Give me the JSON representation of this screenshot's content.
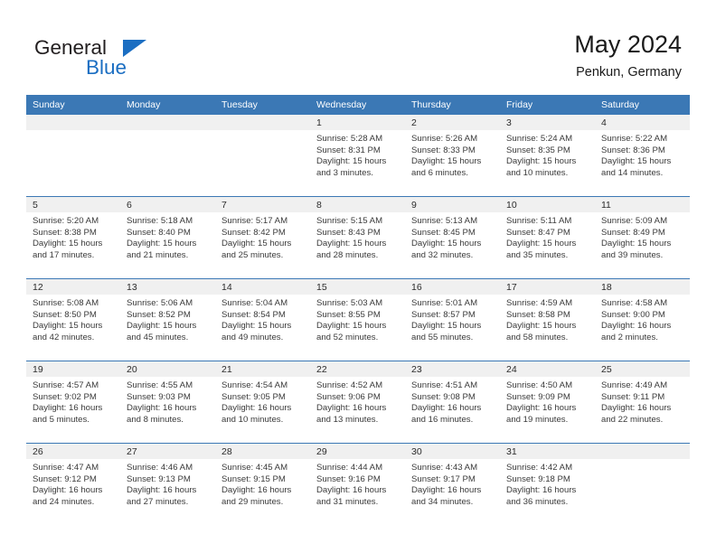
{
  "brand": {
    "word1": "General",
    "word2": "Blue",
    "triangle_color": "#1b6ec2",
    "icon": "triangle-logo-icon"
  },
  "header": {
    "title": "May 2024",
    "subtitle": "Penkun, Germany"
  },
  "theme": {
    "header_blue": "#3b78b5",
    "daynum_band": "#f0f0f0",
    "text": "#3a3a3a"
  },
  "calendar": {
    "weekday_headers": [
      "Sunday",
      "Monday",
      "Tuesday",
      "Wednesday",
      "Thursday",
      "Friday",
      "Saturday"
    ],
    "weeks": [
      [
        {
          "day": "",
          "empty": true,
          "sunrise": "",
          "sunset": "",
          "daylight": ""
        },
        {
          "day": "",
          "empty": true,
          "sunrise": "",
          "sunset": "",
          "daylight": ""
        },
        {
          "day": "",
          "empty": true,
          "sunrise": "",
          "sunset": "",
          "daylight": ""
        },
        {
          "day": "1",
          "empty": false,
          "sunrise": "Sunrise: 5:28 AM",
          "sunset": "Sunset: 8:31 PM",
          "daylight": "Daylight: 15 hours and 3 minutes."
        },
        {
          "day": "2",
          "empty": false,
          "sunrise": "Sunrise: 5:26 AM",
          "sunset": "Sunset: 8:33 PM",
          "daylight": "Daylight: 15 hours and 6 minutes."
        },
        {
          "day": "3",
          "empty": false,
          "sunrise": "Sunrise: 5:24 AM",
          "sunset": "Sunset: 8:35 PM",
          "daylight": "Daylight: 15 hours and 10 minutes."
        },
        {
          "day": "4",
          "empty": false,
          "sunrise": "Sunrise: 5:22 AM",
          "sunset": "Sunset: 8:36 PM",
          "daylight": "Daylight: 15 hours and 14 minutes."
        }
      ],
      [
        {
          "day": "5",
          "empty": false,
          "sunrise": "Sunrise: 5:20 AM",
          "sunset": "Sunset: 8:38 PM",
          "daylight": "Daylight: 15 hours and 17 minutes."
        },
        {
          "day": "6",
          "empty": false,
          "sunrise": "Sunrise: 5:18 AM",
          "sunset": "Sunset: 8:40 PM",
          "daylight": "Daylight: 15 hours and 21 minutes."
        },
        {
          "day": "7",
          "empty": false,
          "sunrise": "Sunrise: 5:17 AM",
          "sunset": "Sunset: 8:42 PM",
          "daylight": "Daylight: 15 hours and 25 minutes."
        },
        {
          "day": "8",
          "empty": false,
          "sunrise": "Sunrise: 5:15 AM",
          "sunset": "Sunset: 8:43 PM",
          "daylight": "Daylight: 15 hours and 28 minutes."
        },
        {
          "day": "9",
          "empty": false,
          "sunrise": "Sunrise: 5:13 AM",
          "sunset": "Sunset: 8:45 PM",
          "daylight": "Daylight: 15 hours and 32 minutes."
        },
        {
          "day": "10",
          "empty": false,
          "sunrise": "Sunrise: 5:11 AM",
          "sunset": "Sunset: 8:47 PM",
          "daylight": "Daylight: 15 hours and 35 minutes."
        },
        {
          "day": "11",
          "empty": false,
          "sunrise": "Sunrise: 5:09 AM",
          "sunset": "Sunset: 8:49 PM",
          "daylight": "Daylight: 15 hours and 39 minutes."
        }
      ],
      [
        {
          "day": "12",
          "empty": false,
          "sunrise": "Sunrise: 5:08 AM",
          "sunset": "Sunset: 8:50 PM",
          "daylight": "Daylight: 15 hours and 42 minutes."
        },
        {
          "day": "13",
          "empty": false,
          "sunrise": "Sunrise: 5:06 AM",
          "sunset": "Sunset: 8:52 PM",
          "daylight": "Daylight: 15 hours and 45 minutes."
        },
        {
          "day": "14",
          "empty": false,
          "sunrise": "Sunrise: 5:04 AM",
          "sunset": "Sunset: 8:54 PM",
          "daylight": "Daylight: 15 hours and 49 minutes."
        },
        {
          "day": "15",
          "empty": false,
          "sunrise": "Sunrise: 5:03 AM",
          "sunset": "Sunset: 8:55 PM",
          "daylight": "Daylight: 15 hours and 52 minutes."
        },
        {
          "day": "16",
          "empty": false,
          "sunrise": "Sunrise: 5:01 AM",
          "sunset": "Sunset: 8:57 PM",
          "daylight": "Daylight: 15 hours and 55 minutes."
        },
        {
          "day": "17",
          "empty": false,
          "sunrise": "Sunrise: 4:59 AM",
          "sunset": "Sunset: 8:58 PM",
          "daylight": "Daylight: 15 hours and 58 minutes."
        },
        {
          "day": "18",
          "empty": false,
          "sunrise": "Sunrise: 4:58 AM",
          "sunset": "Sunset: 9:00 PM",
          "daylight": "Daylight: 16 hours and 2 minutes."
        }
      ],
      [
        {
          "day": "19",
          "empty": false,
          "sunrise": "Sunrise: 4:57 AM",
          "sunset": "Sunset: 9:02 PM",
          "daylight": "Daylight: 16 hours and 5 minutes."
        },
        {
          "day": "20",
          "empty": false,
          "sunrise": "Sunrise: 4:55 AM",
          "sunset": "Sunset: 9:03 PM",
          "daylight": "Daylight: 16 hours and 8 minutes."
        },
        {
          "day": "21",
          "empty": false,
          "sunrise": "Sunrise: 4:54 AM",
          "sunset": "Sunset: 9:05 PM",
          "daylight": "Daylight: 16 hours and 10 minutes."
        },
        {
          "day": "22",
          "empty": false,
          "sunrise": "Sunrise: 4:52 AM",
          "sunset": "Sunset: 9:06 PM",
          "daylight": "Daylight: 16 hours and 13 minutes."
        },
        {
          "day": "23",
          "empty": false,
          "sunrise": "Sunrise: 4:51 AM",
          "sunset": "Sunset: 9:08 PM",
          "daylight": "Daylight: 16 hours and 16 minutes."
        },
        {
          "day": "24",
          "empty": false,
          "sunrise": "Sunrise: 4:50 AM",
          "sunset": "Sunset: 9:09 PM",
          "daylight": "Daylight: 16 hours and 19 minutes."
        },
        {
          "day": "25",
          "empty": false,
          "sunrise": "Sunrise: 4:49 AM",
          "sunset": "Sunset: 9:11 PM",
          "daylight": "Daylight: 16 hours and 22 minutes."
        }
      ],
      [
        {
          "day": "26",
          "empty": false,
          "sunrise": "Sunrise: 4:47 AM",
          "sunset": "Sunset: 9:12 PM",
          "daylight": "Daylight: 16 hours and 24 minutes."
        },
        {
          "day": "27",
          "empty": false,
          "sunrise": "Sunrise: 4:46 AM",
          "sunset": "Sunset: 9:13 PM",
          "daylight": "Daylight: 16 hours and 27 minutes."
        },
        {
          "day": "28",
          "empty": false,
          "sunrise": "Sunrise: 4:45 AM",
          "sunset": "Sunset: 9:15 PM",
          "daylight": "Daylight: 16 hours and 29 minutes."
        },
        {
          "day": "29",
          "empty": false,
          "sunrise": "Sunrise: 4:44 AM",
          "sunset": "Sunset: 9:16 PM",
          "daylight": "Daylight: 16 hours and 31 minutes."
        },
        {
          "day": "30",
          "empty": false,
          "sunrise": "Sunrise: 4:43 AM",
          "sunset": "Sunset: 9:17 PM",
          "daylight": "Daylight: 16 hours and 34 minutes."
        },
        {
          "day": "31",
          "empty": false,
          "sunrise": "Sunrise: 4:42 AM",
          "sunset": "Sunset: 9:18 PM",
          "daylight": "Daylight: 16 hours and 36 minutes."
        },
        {
          "day": "",
          "empty": true,
          "sunrise": "",
          "sunset": "",
          "daylight": ""
        }
      ]
    ]
  }
}
